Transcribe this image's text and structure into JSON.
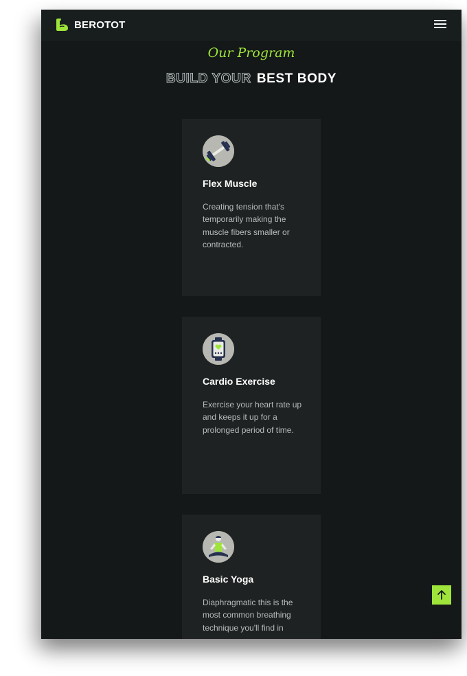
{
  "header": {
    "brand": "BEROTOT",
    "logo_icon": "flexed-arm-icon",
    "menu_icon": "hamburger-icon",
    "accent_color": "#9fe43a"
  },
  "section": {
    "tagline": "Our Program",
    "title_outline": "BUILD YOUR",
    "title_solid": "BEST BODY"
  },
  "programs": [
    {
      "icon": "dumbbell-icon",
      "title": "Flex Muscle",
      "description": "Creating tension that's temporarily making the muscle fibers smaller or contracted."
    },
    {
      "icon": "smartwatch-heart-icon",
      "title": "Cardio Exercise",
      "description": "Exercise your heart rate up and keeps it up for a prolonged period of time."
    },
    {
      "icon": "yoga-pose-icon",
      "title": "Basic Yoga",
      "description": "Diaphragmatic this is the most common breathing technique you'll find in"
    }
  ],
  "scroll_top": {
    "icon": "arrow-up-icon"
  },
  "colors": {
    "background": "#141818",
    "card": "#1f2222",
    "accent": "#9fe43a"
  }
}
